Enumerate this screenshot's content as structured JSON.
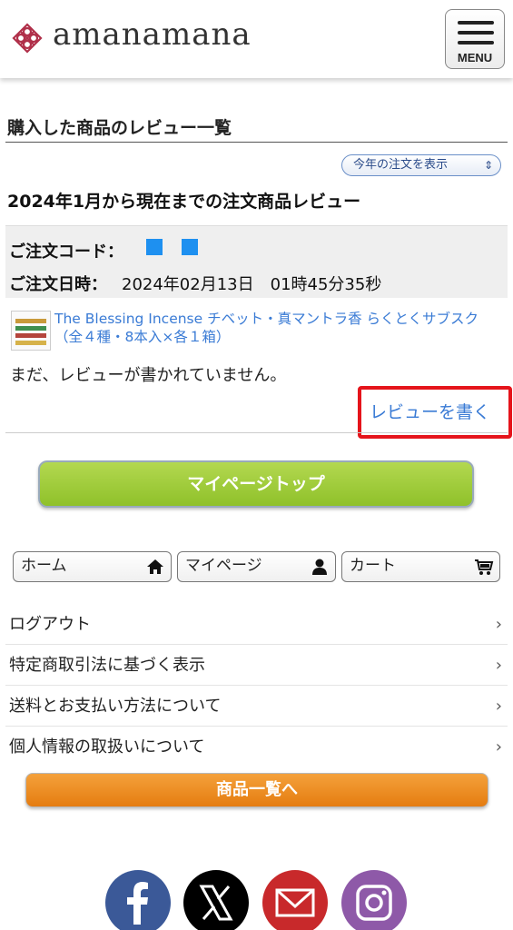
{
  "header": {
    "logo_text": "amanamana",
    "menu_label": "MENU"
  },
  "page": {
    "title": "購入した商品のレビュー一覧",
    "year_select": {
      "selected": "今年の注文を表示"
    },
    "section_title": "2024年1月から現在までの注文商品レビュー"
  },
  "order": {
    "code_label": "ご注文コード：",
    "date_label": "ご注文日時：",
    "date_value": "2024年02月13日　01時45分35秒",
    "product_link": "The Blessing Incense チベット・真マントラ香 らくとくサブスク（全４種・8本入×各１箱）",
    "no_review_text": "まだ、レビューが書かれていません。",
    "write_review_label": "レビューを書く"
  },
  "buttons": {
    "mypage_top": "マイページトップ",
    "products_list": "商品一覧へ"
  },
  "nav": [
    {
      "label": "ホーム",
      "icon": "home-icon"
    },
    {
      "label": "マイページ",
      "icon": "user-icon"
    },
    {
      "label": "カート",
      "icon": "cart-icon"
    }
  ],
  "links": [
    {
      "label": "ログアウト"
    },
    {
      "label": "特定商取引法に基づく表示"
    },
    {
      "label": "送料とお支払い方法について"
    },
    {
      "label": "個人情報の取扱いについて"
    }
  ],
  "social": [
    {
      "icon": "facebook-icon",
      "color": "#3b5998"
    },
    {
      "icon": "x-icon",
      "color": "#000000"
    },
    {
      "icon": "mail-icon",
      "color": "#c8292b"
    },
    {
      "icon": "instagram-icon",
      "color": "#8e59a8"
    }
  ],
  "colors": {
    "link": "#3a7bd5",
    "highlight_border": "#e5141b",
    "mypage_button": "#9acb34",
    "products_button": "#f08c1e"
  }
}
